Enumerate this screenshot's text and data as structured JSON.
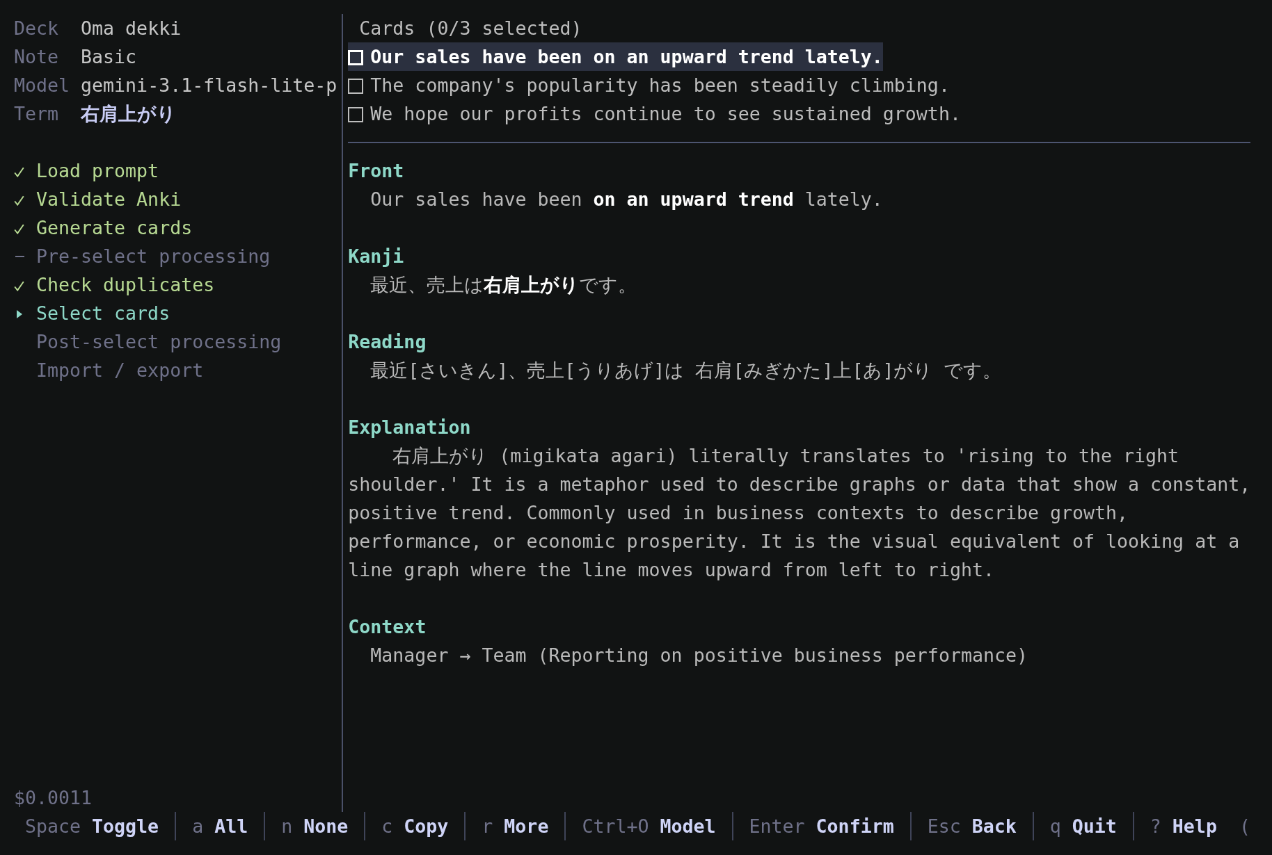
{
  "info": [
    {
      "label": "Deck",
      "value": "Oma dekki",
      "kind": "text"
    },
    {
      "label": "Note",
      "value": "Basic",
      "kind": "text"
    },
    {
      "label": "Model",
      "value": "gemini-3.1-flash-lite-p",
      "kind": "text"
    },
    {
      "label": "Term",
      "value": "右肩上がり",
      "kind": "term"
    }
  ],
  "steps": [
    {
      "label": "Load prompt",
      "kind": "done"
    },
    {
      "label": "Validate Anki",
      "kind": "done"
    },
    {
      "label": "Generate cards",
      "kind": "done"
    },
    {
      "label": "Pre-select processing",
      "kind": "skipped"
    },
    {
      "label": "Check duplicates",
      "kind": "done"
    },
    {
      "label": "Select cards",
      "kind": "current"
    },
    {
      "label": "Post-select processing",
      "kind": "pending"
    },
    {
      "label": "Import / export",
      "kind": "pending"
    }
  ],
  "cost": "$0.0011",
  "cards": {
    "header": "Cards (0/3 selected)",
    "items": [
      {
        "text": "Our sales have been on an upward trend lately.",
        "checked": false,
        "selected": true
      },
      {
        "text": "The company's popularity has been steadily climbing.",
        "checked": false,
        "selected": false
      },
      {
        "text": "We hope our profits continue to see sustained growth.",
        "checked": false,
        "selected": false
      }
    ]
  },
  "fields": [
    {
      "name": "Front",
      "kind": "line",
      "text": "Our sales have been **on an upward trend** lately."
    },
    {
      "name": "Kanji",
      "kind": "line",
      "text": "最近、売上は**右肩上がり**です。"
    },
    {
      "name": "Reading",
      "kind": "line",
      "text": "最近[さいきん]、売上[うりあげ]は 右肩[みぎかた]上[あ]がり です。"
    },
    {
      "name": "Explanation",
      "kind": "paragraph",
      "text": "右肩上がり (migikata agari) literally translates to 'rising to the right shoulder.' It is a metaphor used to describe graphs or data that show a constant, positive trend. Commonly used in business contexts to describe growth, performance, or economic prosperity. It is the visual equivalent of looking at a line graph where the line moves upward from left to right."
    },
    {
      "name": "Context",
      "kind": "line",
      "text": "Manager → Team (Reporting on positive business performance)"
    }
  ],
  "status_bar": {
    "hints": [
      {
        "key": "Space",
        "action": "Toggle"
      },
      {
        "key": "a",
        "action": "All"
      },
      {
        "key": "n",
        "action": "None"
      },
      {
        "key": "c",
        "action": "Copy"
      },
      {
        "key": "r",
        "action": "More"
      },
      {
        "key": "Ctrl+O",
        "action": "Model"
      },
      {
        "key": "Enter",
        "action": "Confirm"
      },
      {
        "key": "Esc",
        "action": "Back"
      },
      {
        "key": "q",
        "action": "Quit"
      },
      {
        "key": "?",
        "action": "Help"
      }
    ],
    "trailing": "("
  }
}
